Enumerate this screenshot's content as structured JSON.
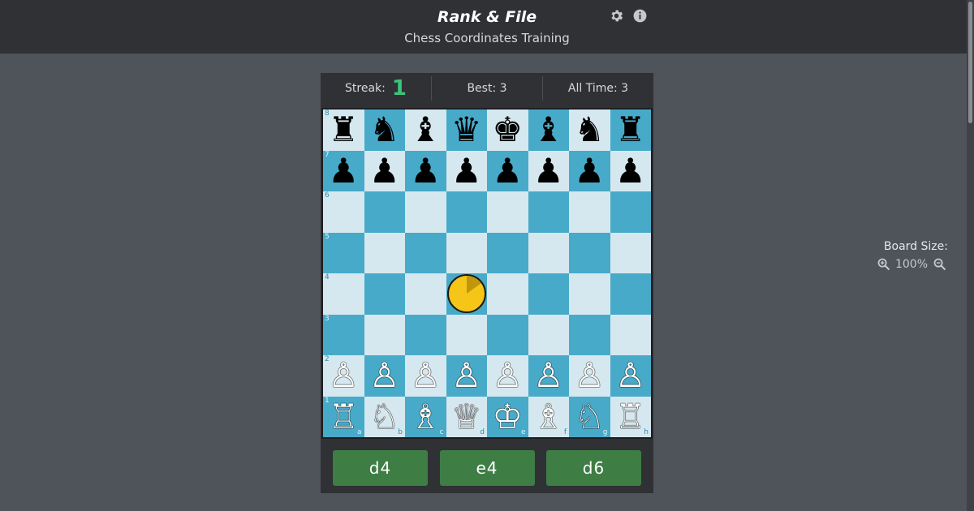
{
  "header": {
    "title": "Rank & File",
    "subtitle": "Chess Coordinates Training",
    "settings_icon": "gear-icon",
    "info_icon": "info-icon"
  },
  "stats": {
    "streak_label": "Streak:",
    "streak_value": "1",
    "best": "Best: 3",
    "all_time": "All Time: 3"
  },
  "board": {
    "colors": {
      "light": "#d6e8ef",
      "dark": "#48aac9",
      "accent": "#3cc37b",
      "button": "#3e7d44",
      "timer": "#f5c518"
    },
    "ranks": [
      "8",
      "7",
      "6",
      "5",
      "4",
      "3",
      "2",
      "1"
    ],
    "files": [
      "a",
      "b",
      "c",
      "d",
      "e",
      "f",
      "g",
      "h"
    ],
    "rows": [
      [
        "♜",
        "♞",
        "♝",
        "♛",
        "♚",
        "♝",
        "♞",
        "♜"
      ],
      [
        "♟",
        "♟",
        "♟",
        "♟",
        "♟",
        "♟",
        "♟",
        "♟"
      ],
      [
        "",
        "",
        "",
        "",
        "",
        "",
        "",
        ""
      ],
      [
        "",
        "",
        "",
        "",
        "",
        "",
        "",
        ""
      ],
      [
        "",
        "",
        "",
        "",
        "",
        "",
        "",
        ""
      ],
      [
        "",
        "",
        "",
        "",
        "",
        "",
        "",
        ""
      ],
      [
        "♙",
        "♙",
        "♙",
        "♙",
        "♙",
        "♙",
        "♙",
        "♙"
      ],
      [
        "♖",
        "♘",
        "♗",
        "♕",
        "♔",
        "♗",
        "♘",
        "♖"
      ]
    ],
    "target_square": "d4",
    "timer_remaining": 0.85
  },
  "answers": [
    "d4",
    "e4",
    "d6"
  ],
  "board_size": {
    "label": "Board Size:",
    "zoom": "100%",
    "zoom_in_icon": "zoom-in-icon",
    "zoom_out_icon": "zoom-out-icon"
  }
}
